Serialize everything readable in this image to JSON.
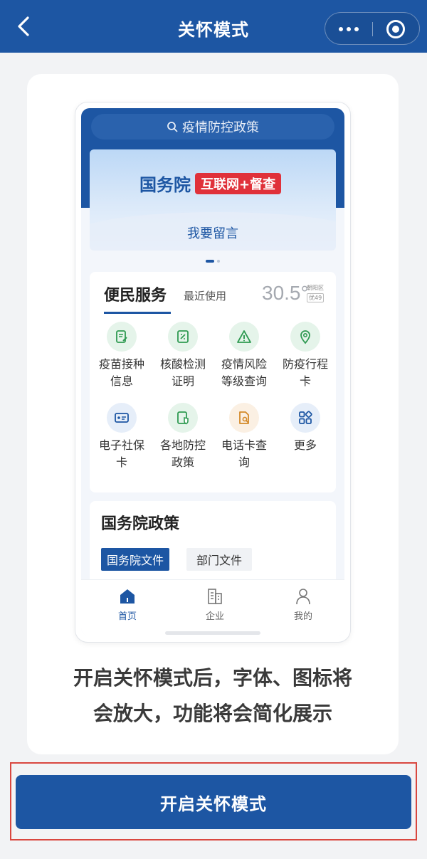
{
  "header": {
    "title": "关怀模式"
  },
  "preview": {
    "search_placeholder": "疫情防控政策",
    "banner": {
      "brand": "国务院",
      "pill": "互联网+督查",
      "cta": "我要留言"
    },
    "services": {
      "title": "便民服务",
      "recent": "最近使用",
      "temperature": "30.5°",
      "location": "朝阳区",
      "aqi": "优49",
      "items": [
        {
          "label_line1": "疫苗接种",
          "label_line2": "信息",
          "icon": "document-edit-icon"
        },
        {
          "label_line1": "核酸检测",
          "label_line2": "证明",
          "icon": "certificate-icon"
        },
        {
          "label_line1": "疫情风险",
          "label_line2": "等级查询",
          "icon": "warning-triangle-icon"
        },
        {
          "label_line1": "防疫行程",
          "label_line2": "卡",
          "icon": "location-pin-icon"
        },
        {
          "label_line1": "电子社保",
          "label_line2": "卡",
          "icon": "id-card-icon"
        },
        {
          "label_line1": "各地防控",
          "label_line2": "政策",
          "icon": "shield-doc-icon"
        },
        {
          "label_line1": "电话卡查",
          "label_line2": "询",
          "icon": "sim-search-icon"
        },
        {
          "label_line1": "更多",
          "label_line2": "",
          "icon": "grid-more-icon"
        }
      ]
    },
    "policy": {
      "title": "国务院政策",
      "tab_active": "国务院文件",
      "tab_other": "部门文件"
    },
    "tabbar": [
      {
        "label": "首页",
        "icon": "home-icon"
      },
      {
        "label": "企业",
        "icon": "building-icon"
      },
      {
        "label": "我的",
        "icon": "user-icon"
      }
    ]
  },
  "description": {
    "line1": "开启关怀模式后，字体、图标将",
    "line2": "会放大，功能将会简化展示"
  },
  "primary_button": "开启关怀模式",
  "colors": {
    "brand_blue": "#1d56a3",
    "highlight_red": "#d9473f"
  }
}
